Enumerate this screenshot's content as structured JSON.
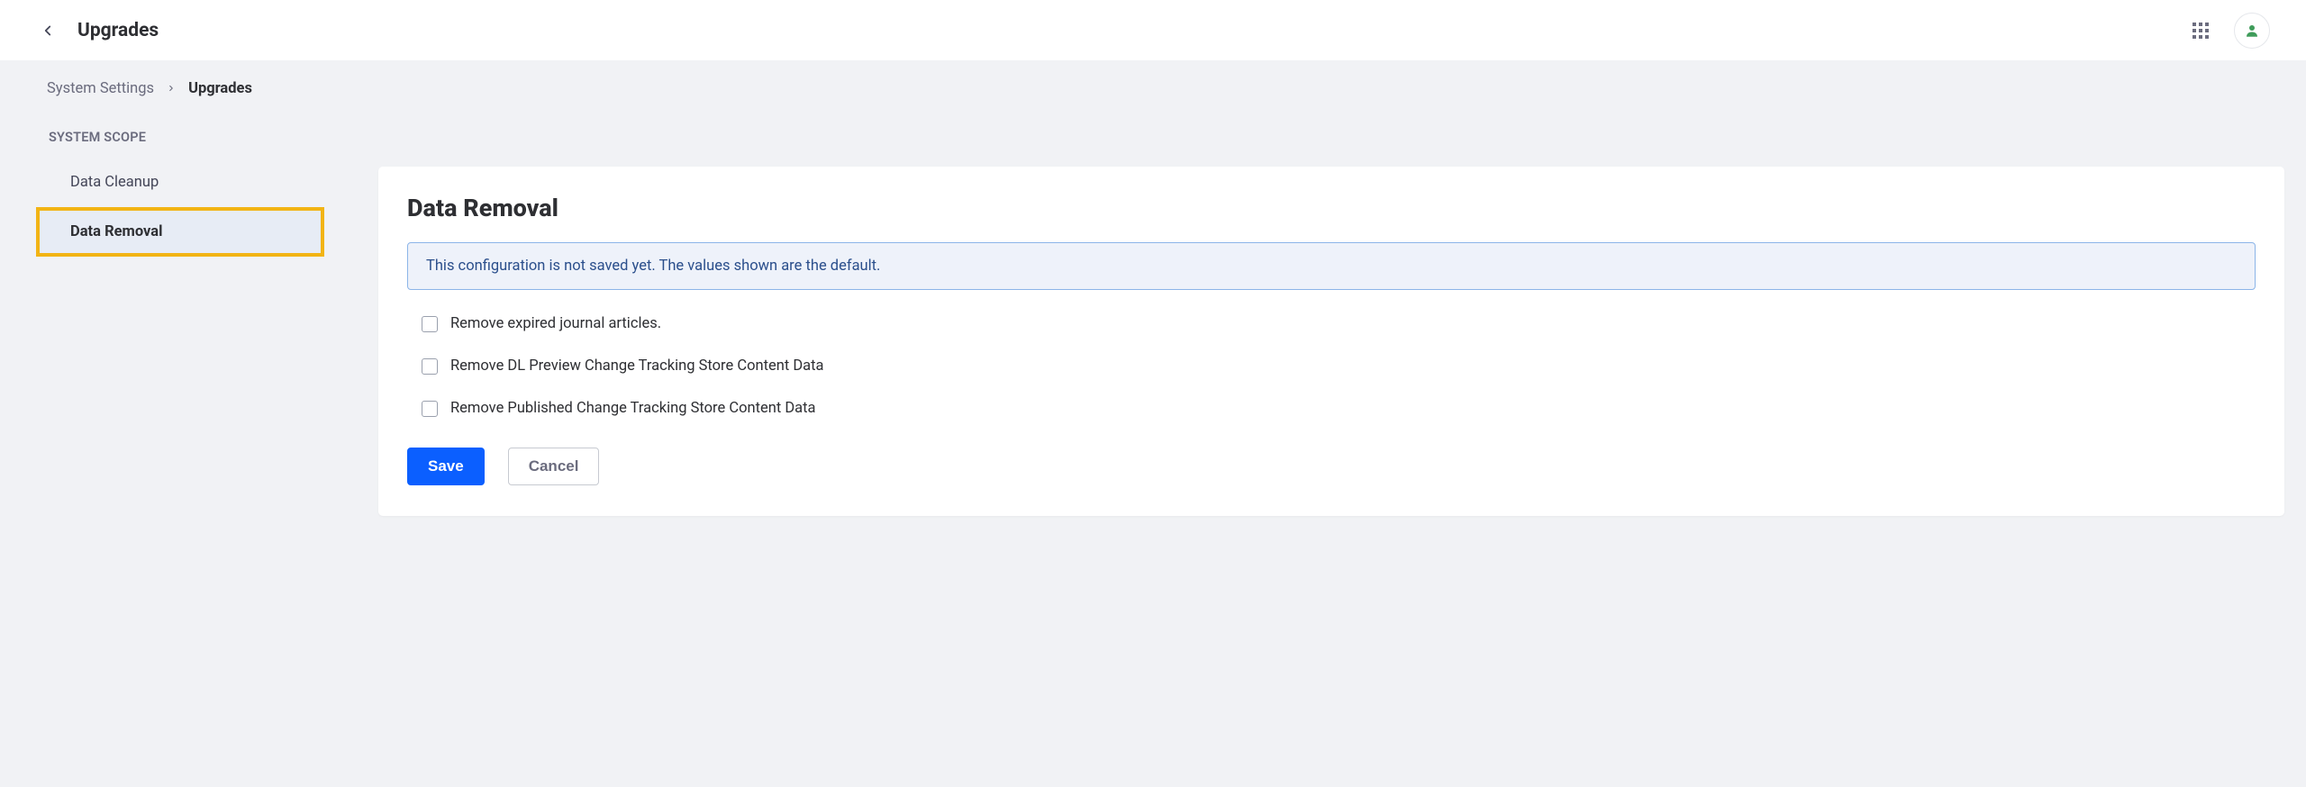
{
  "header": {
    "title": "Upgrades"
  },
  "breadcrumb": {
    "parent": "System Settings",
    "current": "Upgrades"
  },
  "sidebar": {
    "heading": "SYSTEM SCOPE",
    "items": [
      {
        "label": "Data Cleanup",
        "selected": false
      },
      {
        "label": "Data Removal",
        "selected": true
      }
    ]
  },
  "panel": {
    "title": "Data Removal",
    "alert": "This configuration is not saved yet. The values shown are the default.",
    "options": [
      {
        "label": "Remove expired journal articles.",
        "checked": false
      },
      {
        "label": "Remove DL Preview Change Tracking Store Content Data",
        "checked": false
      },
      {
        "label": "Remove Published Change Tracking Store Content Data",
        "checked": false
      }
    ],
    "actions": {
      "save": "Save",
      "cancel": "Cancel"
    }
  }
}
